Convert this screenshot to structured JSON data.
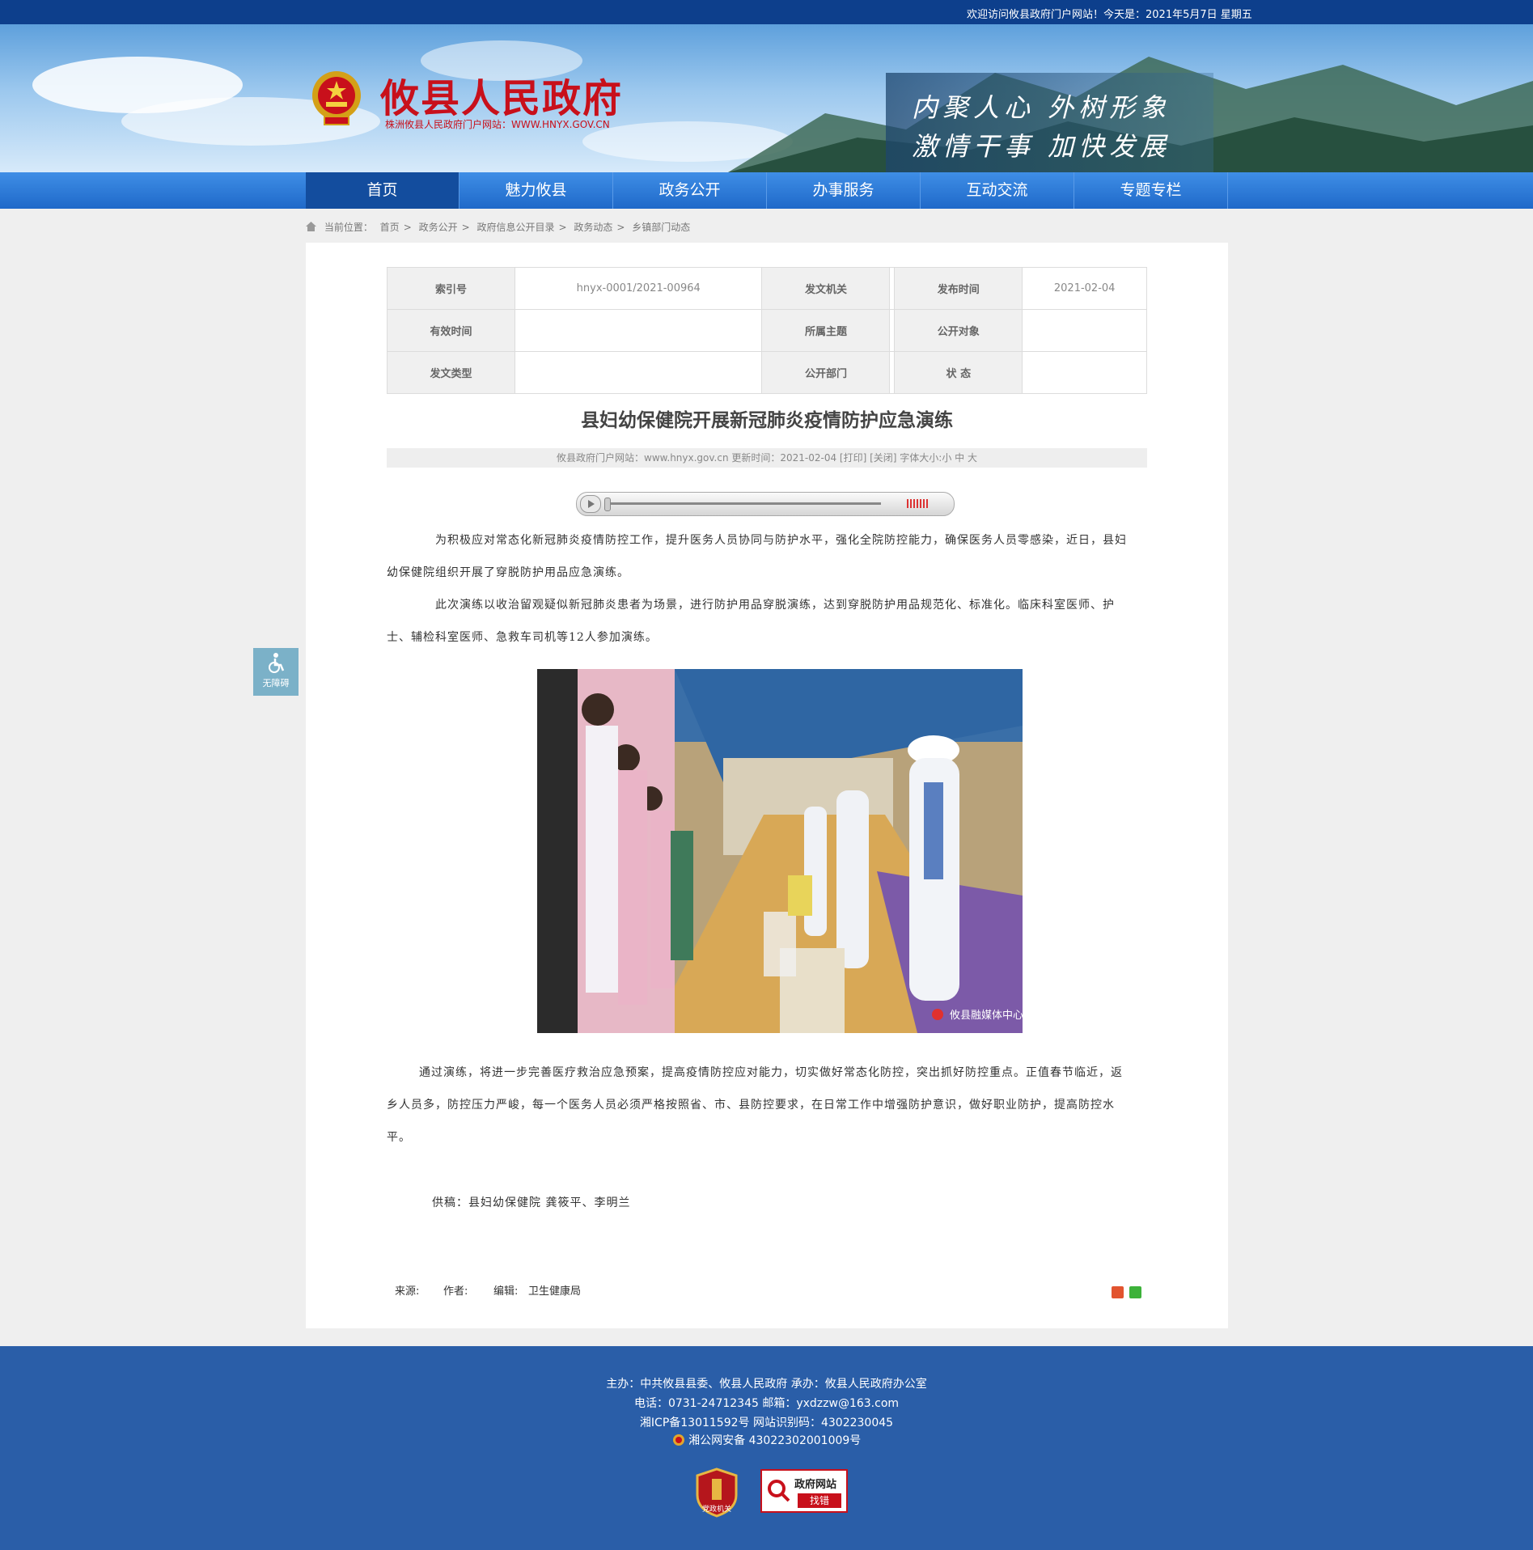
{
  "topbar": {
    "welcome": "欢迎访问攸县政府门户网站！今天是：2021年5月7日 星期五"
  },
  "header": {
    "site_title": "攸县人民政府",
    "site_subtitle": "株洲攸县人民政府门户网站：WWW.HNYX.GOV.CN",
    "slogan_line1": "内聚人心  外树形象",
    "slogan_line2": "激情干事  加快发展"
  },
  "nav": {
    "items": [
      {
        "label": "首页"
      },
      {
        "label": "魅力攸县"
      },
      {
        "label": "政务公开"
      },
      {
        "label": "办事服务"
      },
      {
        "label": "互动交流"
      },
      {
        "label": "专题专栏"
      }
    ],
    "active_index": 0
  },
  "breadcrumb": {
    "prefix": "当前位置：",
    "items": [
      "首页",
      "政务公开",
      "政府信息公开目录",
      "政务动态",
      "乡镇部门动态"
    ],
    "separator": ">"
  },
  "meta_table": {
    "rows": [
      [
        {
          "label": "索引号",
          "value": "hnyx-0001/2021-00964"
        },
        {
          "label": "发文机关",
          "value": ""
        },
        {
          "label": "发布时间",
          "value": "2021-02-04"
        }
      ],
      [
        {
          "label": "有效时间",
          "value": ""
        },
        {
          "label": "所属主题",
          "value": ""
        },
        {
          "label": "公开对象",
          "value": ""
        }
      ],
      [
        {
          "label": "发文类型",
          "value": ""
        },
        {
          "label": "公开部门",
          "value": ""
        },
        {
          "label": "状 态",
          "value": ""
        }
      ]
    ]
  },
  "article": {
    "title": "县妇幼保健院开展新冠肺炎疫情防护应急演练",
    "info_line": "攸县政府门户网站：www.hnyx.gov.cn  更新时间：2021-02-04  [打印] [关闭]  字体大小:小 中 大",
    "para1": "为积极应对常态化新冠肺炎疫情防控工作，提升医务人员协同与防护水平，强化全院防控能力，确保医务人员零感染，近日，县妇幼保健院组织开展了穿脱防护用品应急演练。",
    "para2": "此次演练以收治留观疑似新冠肺炎患者为场景，进行防护用品穿脱演练，达到穿脱防护用品规范化、标准化。临床科室医师、护士、辅检科室医师、急救车司机等12人参加演练。",
    "photo_watermark": "攸县融媒体中心",
    "para3": "通过演练，将进一步完善医疗救治应急预案，提高疫情防控应对能力，切实做好常态化防控，突出抓好防控重点。正值春节临近，返乡人员多，防控压力严峻，每一个医务人员必须严格按照省、市、县防控要求，在日常工作中增强防护意识，做好职业防护，提高防控水平。",
    "credit": "供稿：县妇幼保健院    龚筱平、李明兰",
    "source_label": "来源:",
    "author_label": "作者:",
    "editor_label": "编辑:",
    "editor_value": "卫生健康局"
  },
  "accessibility": {
    "label": "无障碍"
  },
  "footer": {
    "line1": "主办：中共攸县县委、攸县人民政府 承办：攸县人民政府办公室",
    "line2": "电话：0731-24712345 邮箱：yxdzzw@163.com",
    "line3": "湘ICP备13011592号    网站识别码：4302230045",
    "line4": "湘公网安备 43022302001009号",
    "badge1_text": "党政机关",
    "badge2_line1": "政府网站",
    "badge2_line2": "找错"
  },
  "colors": {
    "topbar": "#0d3f8c",
    "nav": "#2a72d4",
    "nav_active": "#134d9e",
    "title_red": "#c8101b",
    "footer": "#2a5ea8"
  }
}
